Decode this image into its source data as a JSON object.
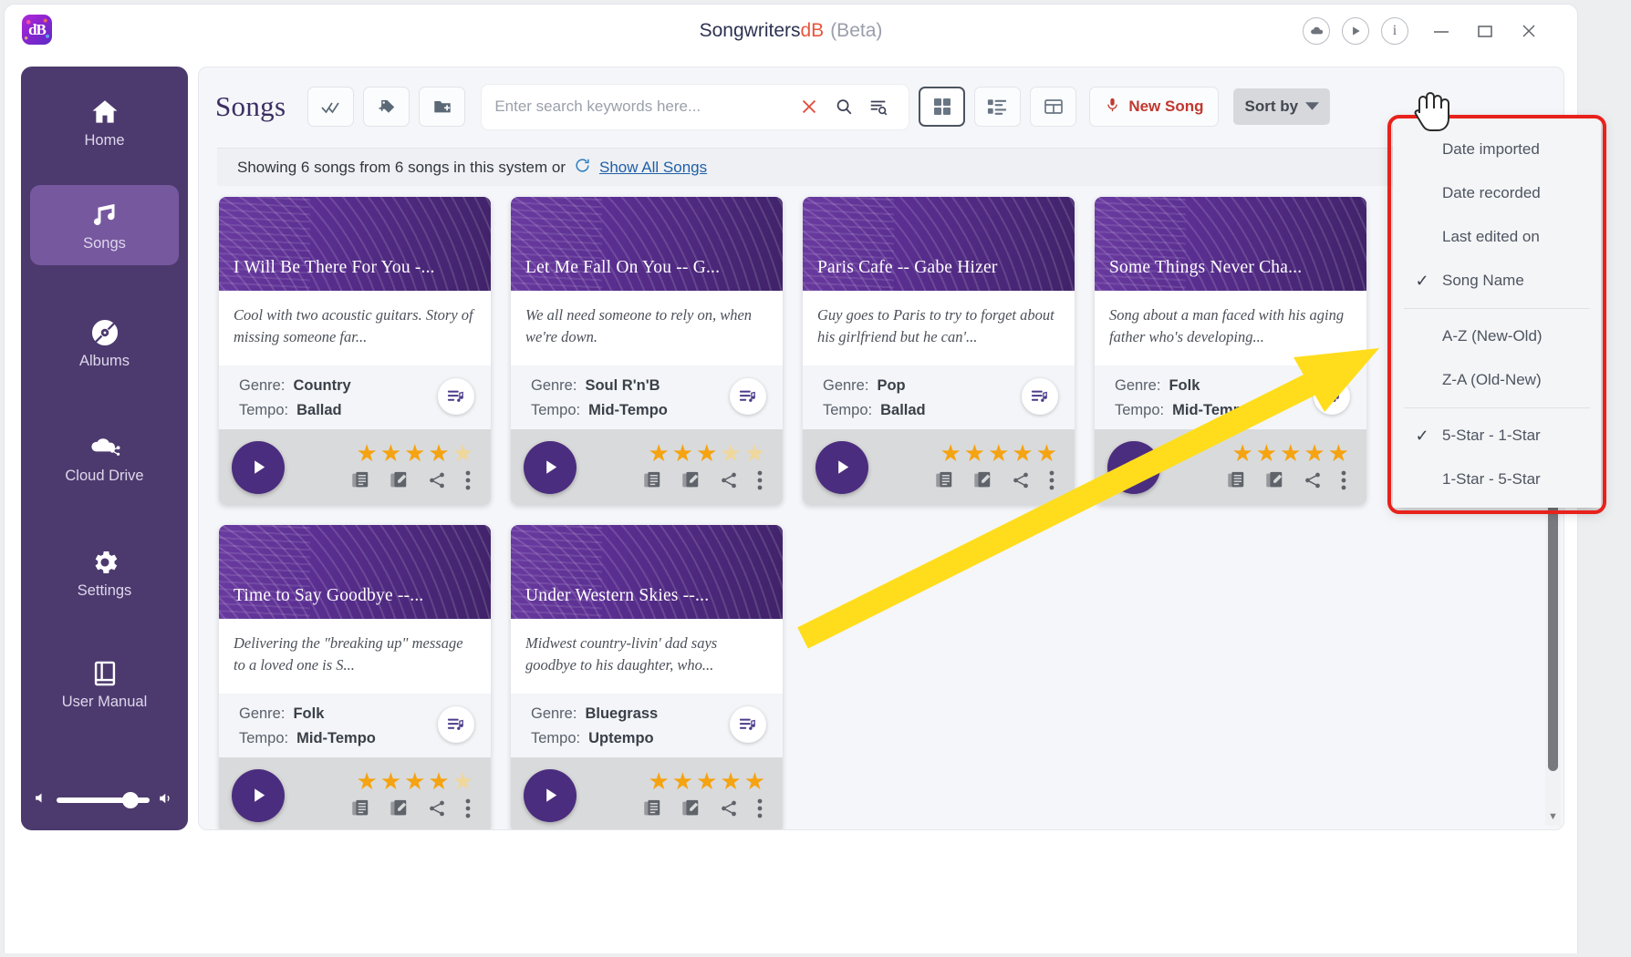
{
  "window": {
    "logo_text": "dB",
    "title_part1": "Songwriters",
    "title_part2": "dB",
    "title_part3": "(Beta)",
    "controls": [
      "cloud-icon",
      "play-icon",
      "info-icon",
      "minimize",
      "maximize",
      "close"
    ]
  },
  "sidebar": {
    "items": [
      {
        "label": "Home",
        "icon": "home-icon",
        "active": false
      },
      {
        "label": "Songs",
        "icon": "music-note-icon",
        "active": true
      },
      {
        "label": "Albums",
        "icon": "disc-icon",
        "active": false
      },
      {
        "label": "Cloud Drive",
        "icon": "cloud-share-icon",
        "active": false
      },
      {
        "label": "Settings",
        "icon": "gear-icon",
        "active": false
      },
      {
        "label": "User Manual",
        "icon": "book-icon",
        "active": false
      }
    ],
    "volume": {
      "value": 88
    }
  },
  "toolbar": {
    "page_title": "Songs",
    "select_all_label": "select-all",
    "tag_label": "add-tag",
    "folder_label": "add-folder",
    "new_song_label": "New Song",
    "sort_by_label": "Sort by",
    "views": [
      {
        "name": "grid-view",
        "active": true
      },
      {
        "name": "list-view",
        "active": false
      },
      {
        "name": "table-view",
        "active": false
      }
    ]
  },
  "search": {
    "value": "",
    "placeholder": "Enter search keywords here..."
  },
  "infobar": {
    "text": "Showing 6 songs from 6 songs in this system  or",
    "link": "Show All Songs"
  },
  "sort_menu": {
    "items": [
      {
        "label": "Date imported",
        "checked": false
      },
      {
        "label": "Date recorded",
        "checked": false
      },
      {
        "label": "Last edited on",
        "checked": false
      },
      {
        "label": "Song Name",
        "checked": true
      },
      {
        "separator": true
      },
      {
        "label": "A-Z (New-Old)",
        "checked": false
      },
      {
        "label": "Z-A (Old-New)",
        "checked": false
      },
      {
        "separator": true
      },
      {
        "label": "5-Star - 1-Star",
        "checked": true
      },
      {
        "label": "1-Star - 5-Star",
        "checked": false
      }
    ]
  },
  "songs": [
    {
      "title": "I Will Be There For You -...",
      "description": "Cool with two acoustic guitars. Story of missing someone far...",
      "genre_label": "Genre:",
      "genre": "Country",
      "tempo_label": "Tempo:",
      "tempo": "Ballad",
      "rating": 4
    },
    {
      "title": "Let Me Fall On You -- G...",
      "description": "We all need someone to rely on, when we're down.",
      "genre_label": "Genre:",
      "genre": "Soul R'n'B",
      "tempo_label": "Tempo:",
      "tempo": "Mid-Tempo",
      "rating": 3
    },
    {
      "title": "Paris Cafe -- Gabe Hizer",
      "description": "Guy goes to Paris to try to forget about his girlfriend but he can'...",
      "genre_label": "Genre:",
      "genre": "Pop",
      "tempo_label": "Tempo:",
      "tempo": "Ballad",
      "rating": 5
    },
    {
      "title": "Some Things Never Cha...",
      "description": "Song about a man faced with his aging father who's developing...",
      "genre_label": "Genre:",
      "genre": "Folk",
      "tempo_label": "Tempo:",
      "tempo": "Mid-Tempo",
      "rating": 5
    },
    {
      "title": "Time to Say Goodbye --...",
      "description": "Delivering the \"breaking up\" message to a loved one is S...",
      "genre_label": "Genre:",
      "genre": "Folk",
      "tempo_label": "Tempo:",
      "tempo": "Mid-Tempo",
      "rating": 4
    },
    {
      "title": "Under Western Skies --...",
      "description": "Midwest country-livin' dad says goodbye to his daughter, who...",
      "genre_label": "Genre:",
      "genre": "Bluegrass",
      "tempo_label": "Tempo:",
      "tempo": "Uptempo",
      "rating": 5
    }
  ],
  "colors": {
    "sidebar_bg": "#4c3a6e",
    "sidebar_active": "#76589f",
    "card_header": "#5b2f92",
    "play_button": "#4b2d7f",
    "star_on": "#f5a310",
    "star_off": "#f0d79a",
    "new_song_red": "#c0392f",
    "highlight_box": "#e8211b",
    "annotation_arrow": "#ffdd1c",
    "link_blue": "#1f5fa8"
  }
}
